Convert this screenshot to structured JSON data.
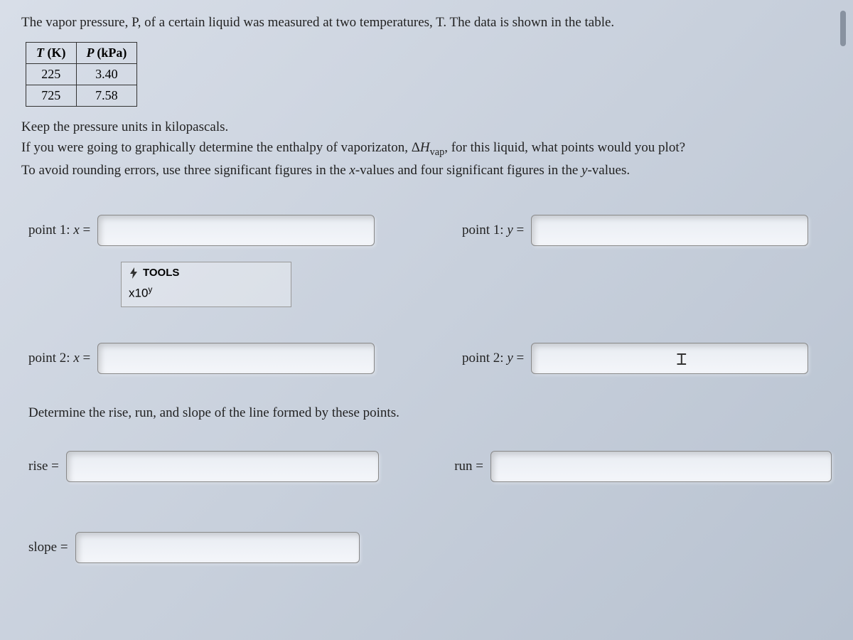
{
  "question": {
    "intro": "The vapor pressure, P, of a certain liquid was measured at two temperatures, T. The data is shown in the table.",
    "table": {
      "headers": {
        "col1_var": "T",
        "col1_unit": "(K)",
        "col2_var": "P",
        "col2_unit": "(kPa)"
      },
      "rows": [
        {
          "t": "225",
          "p": "3.40"
        },
        {
          "t": "725",
          "p": "7.58"
        }
      ]
    },
    "instr_line1": "Keep the pressure units in kilopascals.",
    "instr_line2_a": "If you were going to graphically determine the enthalpy of vaporizaton, Δ",
    "instr_line2_h": "H",
    "instr_line2_sub": "vap",
    "instr_line2_b": ", for this liquid, what points would you plot?",
    "instr_line3_a": "To avoid rounding errors, use three significant figures in the ",
    "instr_line3_x": "x",
    "instr_line3_b": "-values and four significant figures in the ",
    "instr_line3_y": "y",
    "instr_line3_c": "-values."
  },
  "labels": {
    "p1x_a": "point 1: ",
    "p1x_var": "x",
    "p1x_b": " =",
    "p1y_a": "point 1: ",
    "p1y_var": "y",
    "p1y_b": " =",
    "p2x_a": "point 2: ",
    "p2x_var": "x",
    "p2x_b": " =",
    "p2y_a": "point 2: ",
    "p2y_var": "y",
    "p2y_b": " =",
    "rise": "rise =",
    "run": "run =",
    "slope": "slope ="
  },
  "tools": {
    "header": "TOOLS",
    "sci_base": "x10",
    "sci_exp": "y"
  },
  "section2": "Determine the rise, run, and slope of the line formed by these points.",
  "values": {
    "p1x": "",
    "p1y": "",
    "p2x": "",
    "p2y": "",
    "rise": "",
    "run": "",
    "slope": ""
  }
}
